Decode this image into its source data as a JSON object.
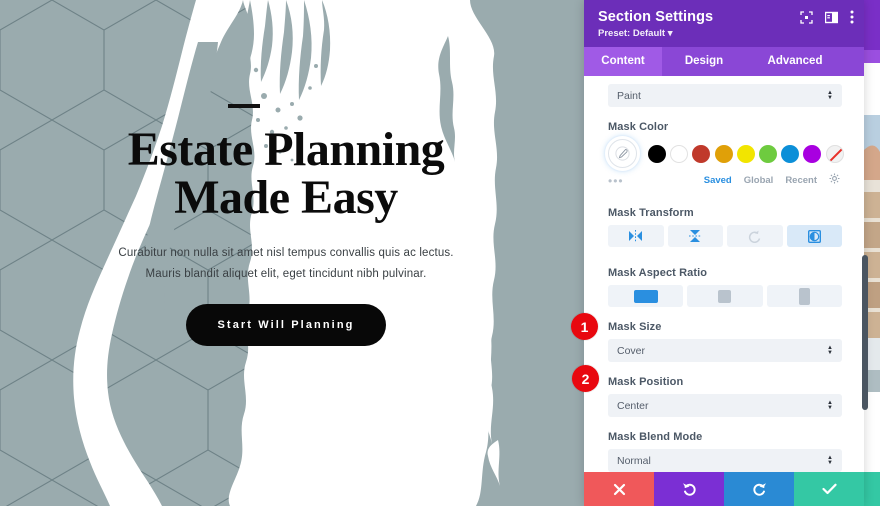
{
  "canvas": {
    "hero": {
      "title_line1": "Estate Planning",
      "title_line2": "Made Easy",
      "subtitle_line1": "Curabitur non nulla sit amet nisl tempus convallis quis ac lectus.",
      "subtitle_line2": "Mauris blandit aliquet elit, eget tincidunt nibh pulvinar.",
      "cta_label": "Start Will Planning"
    },
    "badges": [
      {
        "number": "1"
      },
      {
        "number": "2"
      }
    ],
    "background_color": "#9aabae",
    "mask_color": "#ffffff"
  },
  "panel": {
    "header": {
      "title": "Section Settings",
      "preset": "Preset: Default",
      "icons": [
        {
          "name": "fullscreen-icon"
        },
        {
          "name": "layout-panel-icon"
        },
        {
          "name": "more-vertical-icon"
        }
      ]
    },
    "tabs": [
      {
        "label": "Content",
        "active": true
      },
      {
        "label": "Design",
        "active": false
      },
      {
        "label": "Advanced",
        "active": false
      }
    ],
    "fields": {
      "mask_style": {
        "label": "",
        "value": "Paint"
      },
      "mask_color": {
        "label": "Mask Color",
        "swatches": [
          {
            "name": "black",
            "hex": "#000000"
          },
          {
            "name": "white",
            "hex": "#ffffff"
          },
          {
            "name": "red",
            "hex": "#c0392b"
          },
          {
            "name": "orange",
            "hex": "#e0a008"
          },
          {
            "name": "yellow",
            "hex": "#f2e500"
          },
          {
            "name": "green",
            "hex": "#6ecb3f"
          },
          {
            "name": "blue",
            "hex": "#0c8fd8"
          },
          {
            "name": "purple",
            "hex": "#a800e0"
          },
          {
            "name": "transparent",
            "hex": "transparent"
          }
        ],
        "tabs": [
          {
            "label": "Saved",
            "active": true
          },
          {
            "label": "Global",
            "active": false
          },
          {
            "label": "Recent",
            "active": false
          }
        ],
        "more_dots": "•••"
      },
      "mask_transform": {
        "label": "Mask Transform",
        "buttons": [
          {
            "name": "flip-horizontal-icon",
            "state": "enabled"
          },
          {
            "name": "flip-vertical-icon",
            "state": "enabled"
          },
          {
            "name": "rotate-icon",
            "state": "disabled"
          },
          {
            "name": "invert-icon",
            "state": "active"
          }
        ]
      },
      "mask_aspect_ratio": {
        "label": "Mask Aspect Ratio",
        "buttons": [
          {
            "name": "ratio-landscape",
            "state": "active"
          },
          {
            "name": "ratio-square",
            "state": "enabled"
          },
          {
            "name": "ratio-portrait",
            "state": "enabled"
          }
        ]
      },
      "mask_size": {
        "label": "Mask Size",
        "value": "Cover"
      },
      "mask_position": {
        "label": "Mask Position",
        "value": "Center"
      },
      "mask_blend_mode": {
        "label": "Mask Blend Mode",
        "value": "Normal"
      }
    },
    "footer": [
      {
        "name": "cancel-button",
        "icon": "✖",
        "color": "#f0585a"
      },
      {
        "name": "undo-button",
        "icon": "↺",
        "color": "#7b2fd4"
      },
      {
        "name": "redo-button",
        "icon": "↻",
        "color": "#2a8ad4"
      },
      {
        "name": "save-button",
        "icon": "✔",
        "color": "#34c8a4"
      }
    ],
    "accent_colors": {
      "header": "#6c2eb9",
      "tabbar": "#8a47d6",
      "tab_active": "#a05ae6"
    }
  }
}
